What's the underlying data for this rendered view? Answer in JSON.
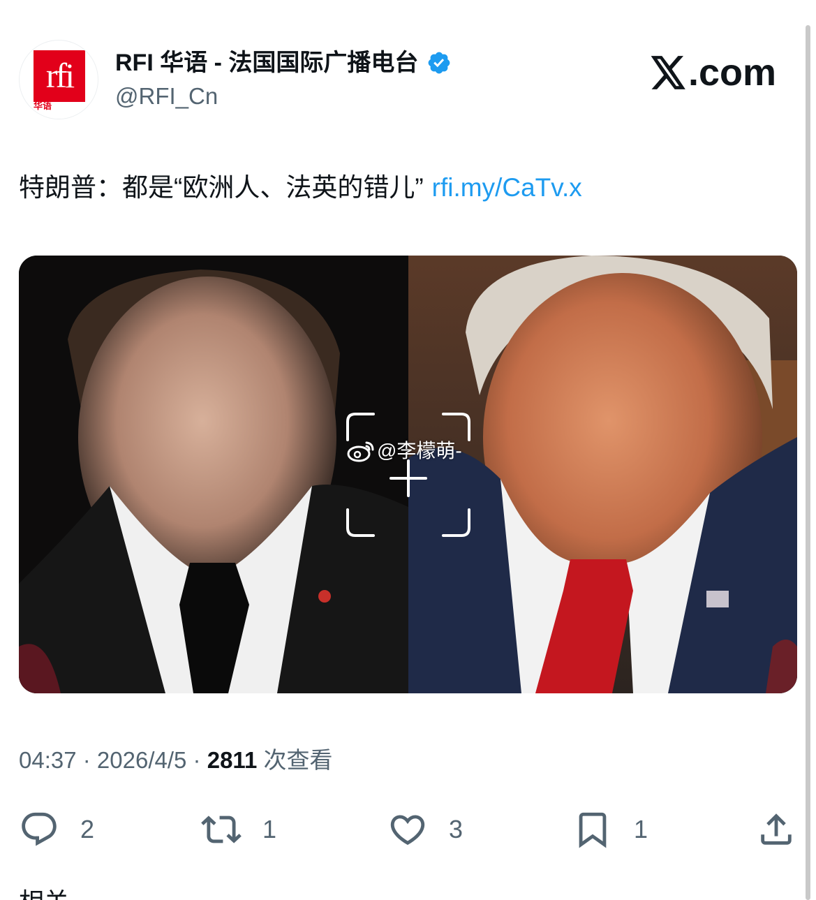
{
  "author": {
    "name": "RFI 华语 - 法国国际广播电台",
    "handle": "@RFI_Cn",
    "avatar_logo_text": "rfi",
    "avatar_logo_subtext": "华语",
    "verified": true,
    "verified_color": "#1d9bf0"
  },
  "site": {
    "label": ".com",
    "logo": "x-logo-icon"
  },
  "tweet": {
    "text": "特朗普：都是“欧洲人、法英的错儿”",
    "link": "rfi.my/CaTv.x",
    "link_color": "#1d9bf0"
  },
  "media": {
    "watermark_text": "@李檬萌-",
    "watermark_icon": "weibo-icon"
  },
  "meta": {
    "time": "04:37",
    "sep1": " · ",
    "date": "2026/4/5",
    "sep2": " · ",
    "views": "2811",
    "views_label": " 次查看"
  },
  "actions": {
    "reply": {
      "icon": "reply-icon",
      "count": "2"
    },
    "retweet": {
      "icon": "retweet-icon",
      "count": "1"
    },
    "like": {
      "icon": "heart-icon",
      "count": "3"
    },
    "bookmark": {
      "icon": "bookmark-icon",
      "count": "1"
    },
    "share": {
      "icon": "share-icon"
    }
  },
  "partial_next_text": "相关"
}
